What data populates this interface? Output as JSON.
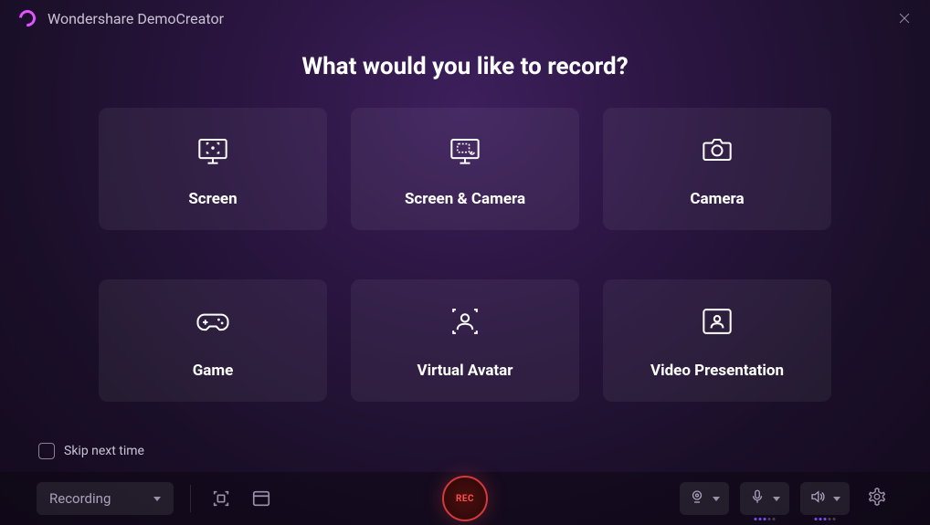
{
  "header": {
    "app_title": "Wondershare DemoCreator"
  },
  "heading": "What would you like to record?",
  "options": [
    {
      "label": "Screen"
    },
    {
      "label": "Screen & Camera"
    },
    {
      "label": "Camera"
    },
    {
      "label": "Game"
    },
    {
      "label": "Virtual Avatar"
    },
    {
      "label": "Video Presentation"
    }
  ],
  "skip": {
    "label": "Skip next time"
  },
  "bottom": {
    "mode_label": "Recording",
    "rec_label": "REC"
  }
}
